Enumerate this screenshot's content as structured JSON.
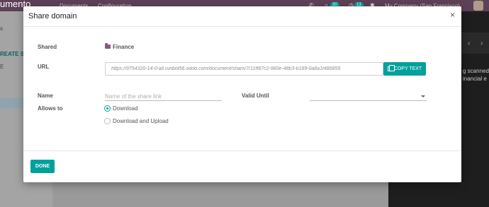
{
  "background": {
    "app_title": "umento",
    "menu": [
      "Documents",
      "Configuration"
    ],
    "chat_badge": "30",
    "activity_badge": "13",
    "company": "My Company (San Francisco)",
    "left_fragment_top": "s",
    "create_fragment": "REATE S",
    "left_fragment_mid": "E",
    "right_text_1": "g scanned",
    "right_text_2": "inancial e"
  },
  "dialog": {
    "title": "Share domain",
    "close_glyph": "×",
    "shared_label": "Shared",
    "shared_value": "Finance",
    "url_label": "URL",
    "url_value": "https://9754320-14-0-all.runbot56.odoo.com/document/share/7/11ff87c2-980e-48b3-b189-0a8a1f486855",
    "copy_button": "COPY TEXT",
    "name_label": "Name",
    "name_placeholder": "Name of the share link",
    "valid_until_label": "Valid Until",
    "valid_until_value": "",
    "allows_to_label": "Allows to",
    "option_download": "Download",
    "option_download_upload": "Download and Upload",
    "done_button": "DONE"
  },
  "colors": {
    "accent": "#00a09d",
    "brand": "#875a7b",
    "topbar": "#5d4257"
  }
}
